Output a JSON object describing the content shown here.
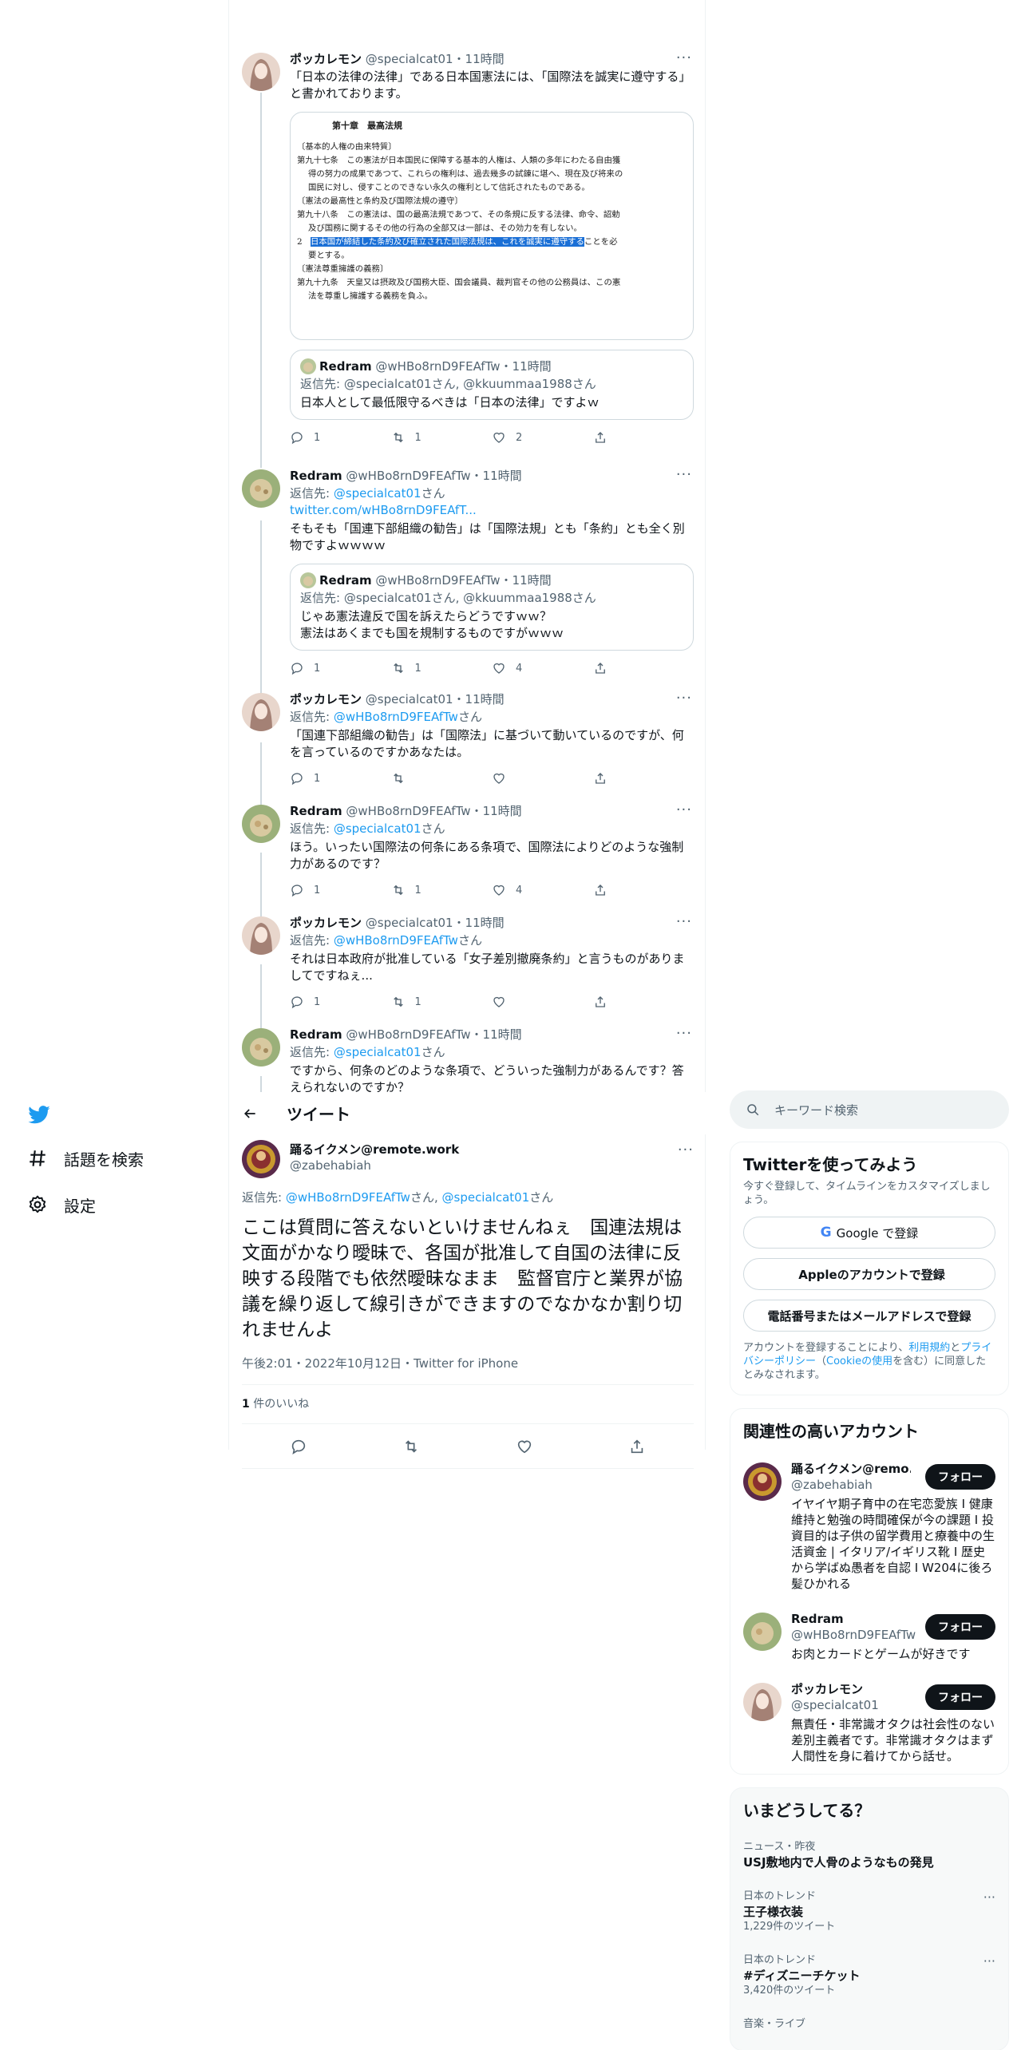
{
  "colors": {
    "accent": "#1d9bf0",
    "text": "#0f1419",
    "muted": "#536471",
    "border": "#eff3f4"
  },
  "thread": [
    {
      "name": "ポッカレモン",
      "handle": "@specialcat01",
      "time": "・11時間",
      "text": "「日本の法律の法律」である日本国憲法には、「国際法を誠実に遵守する」と書かれております。",
      "doc": {
        "title": "第十章　最高法規",
        "lines": [
          "〔基本的人権の由来特質〕",
          "第九十七条　この憲法が日本国民に保障する基本的人権は、人類の多年にわたる自由獲",
          "得の努力の成果であつて、これらの権利は、過去幾多の試錬に堪へ、現在及び将来の",
          "国民に対し、侵すことのできない永久の権利として信託されたものである。",
          "〔憲法の最高性と条約及び国際法規の遵守〕",
          "第九十八条　この憲法は、国の最高法規であつて、その条規に反する法律、命令、詔勅",
          "及び国務に関するその他の行為の全部又は一部は、その効力を有しない。"
        ],
        "hl_pre": "2　",
        "hl": "日本国が締結した条約及び確立された国際法規は、これを誠実に遵守する",
        "hl_post": "ことを必",
        "lines2": [
          "要とする。",
          "〔憲法尊重擁護の義務〕",
          "第九十九条　天皇又は摂政及び国務大臣、国会議員、裁判官その他の公務員は、この憲",
          "法を尊重し擁護する義務を負ふ。"
        ]
      },
      "quote": {
        "name": "Redram",
        "handle": "@wHBo8rnD9FEAfTw",
        "time": "・11時間",
        "reply": "返信先: @specialcat01さん, @kkuummaa1988さん",
        "text": "日本人として最低限守るべきは「日本の法律」ですよｗ"
      },
      "stats": {
        "reply": "1",
        "retweet": "1",
        "like": "2"
      }
    },
    {
      "name": "Redram",
      "handle": "@wHBo8rnD9FEAfTw",
      "time": "・11時間",
      "reply_prefix": "返信先: ",
      "reply_to": "@specialcat01",
      "reply_suffix": "さん",
      "link": "twitter.com/wHBo8rnD9FEAfT...",
      "text": "そもそも「国連下部組織の勧告」は「国際法規」とも「条約」とも全く別物ですよｗｗｗｗ",
      "quote": {
        "name": "Redram",
        "handle": "@wHBo8rnD9FEAfTw",
        "time": "・11時間",
        "reply": "返信先: @specialcat01さん, @kkuummaa1988さん",
        "text": "じゃあ憲法違反で国を訴えたらどうですｗｗ？\n憲法はあくまでも国を規制するものですがｗｗｗ"
      },
      "stats": {
        "reply": "1",
        "retweet": "1",
        "like": "4"
      }
    },
    {
      "name": "ポッカレモン",
      "handle": "@specialcat01",
      "time": "・11時間",
      "reply_prefix": "返信先: ",
      "reply_to": "@wHBo8rnD9FEAfTw",
      "reply_suffix": "さん",
      "text": "「国連下部組織の勧告」は「国際法」に基づいて動いているのですが、何を言っているのですかあなたは。",
      "stats": {
        "reply": "1",
        "retweet": "",
        "like": ""
      }
    },
    {
      "name": "Redram",
      "handle": "@wHBo8rnD9FEAfTw",
      "time": "・11時間",
      "reply_prefix": "返信先: ",
      "reply_to": "@specialcat01",
      "reply_suffix": "さん",
      "text": "ほう。いったい国際法の何条にある条項で、国際法によりどのような強制力があるのです？",
      "stats": {
        "reply": "1",
        "retweet": "1",
        "like": "4"
      }
    },
    {
      "name": "ポッカレモン",
      "handle": "@specialcat01",
      "time": "・11時間",
      "reply_prefix": "返信先: ",
      "reply_to": "@wHBo8rnD9FEAfTw",
      "reply_suffix": "さん",
      "text": "それは日本政府が批准している「女子差別撤廃条約」と言うものがありましてですねぇ...",
      "stats": {
        "reply": "1",
        "retweet": "1",
        "like": ""
      }
    },
    {
      "name": "Redram",
      "handle": "@wHBo8rnD9FEAfTw",
      "time": "・11時間",
      "reply_prefix": "返信先: ",
      "reply_to": "@specialcat01",
      "reply_suffix": "さん",
      "text": "ですから、何条のどのような条項で、どういった強制力があるんです？答えられないのですか？"
    }
  ],
  "header": {
    "title": "ツイート"
  },
  "main": {
    "name": "踊るイクメン@remote.work",
    "handle": "@zabehabiah",
    "reply_prefix": "返信先: ",
    "reply_to1": "@wHBo8rnD9FEAfTw",
    "mid": "さん, ",
    "reply_to2": "@specialcat01",
    "reply_suffix": "さん",
    "text": "ここは質問に答えないといけませんねぇ　国連法規は文面がかなり曖昧で、各国が批准して自国の法律に反映する段階でも依然曖昧なまま　監督官庁と業界が協議を繰り返して線引きができますのでなかなか割り切れませんよ",
    "meta": "午後2:01・2022年10月12日・Twitter for iPhone",
    "likes_count": "1",
    "likes_label": " 件のいいね"
  },
  "nav": {
    "items": [
      {
        "label": "話題を検索"
      },
      {
        "label": "設定"
      }
    ]
  },
  "search": {
    "placeholder": "キーワード検索"
  },
  "signup": {
    "title": "Twitterを使ってみよう",
    "desc": "今すぐ登録して、タイムラインをカスタマイズしましょう。",
    "google": "Google で登録",
    "apple": "Appleのアカウントで登録",
    "phone": "電話番号またはメールアドレスで登録",
    "terms_pre": "アカウントを登録することにより、",
    "terms": "利用規約",
    "and": "と",
    "privacy": "プライバシーポリシー",
    "cookie_pre": "（",
    "cookie": "Cookieの使用",
    "terms_post": "を含む）に同意したとみなされます。"
  },
  "related": {
    "title": "関連性の高いアカウント",
    "follow": "フォロー",
    "accounts": [
      {
        "name": "踊るイクメン@remo...",
        "handle": "@zabehabiah",
        "bio": "イヤイヤ期子育中の在宅恋愛族 I 健康維持と勉強の時間確保が今の課題 I 投資目的は子供の留学費用と療養中の生活資金 | イタリア/イギリス靴 I 歴史から学ばぬ愚者を自認 I W204に後ろ髪ひかれる"
      },
      {
        "name": "Redram",
        "handle": "@wHBo8rnD9FEAfTw",
        "bio": "お肉とカードとゲームが好きです"
      },
      {
        "name": "ポッカレモン",
        "handle": "@specialcat01",
        "bio": "無責任・非常識オタクは社会性のない差別主義者です。非常識オタクはまず人間性を身に着けてから話せ。"
      }
    ]
  },
  "trends": {
    "title": "いまどうしてる？",
    "items": [
      {
        "category": "ニュース・昨夜",
        "name": "USJ敷地内で人骨のようなもの発見",
        "count": ""
      },
      {
        "category": "日本のトレンド",
        "name": "王子様衣装",
        "count": "1,229件のツイート"
      },
      {
        "category": "日本のトレンド",
        "name": "#ディズニーチケット",
        "count": "3,420件のツイート"
      },
      {
        "category": "音楽・ライブ",
        "name": "",
        "count": ""
      }
    ]
  }
}
